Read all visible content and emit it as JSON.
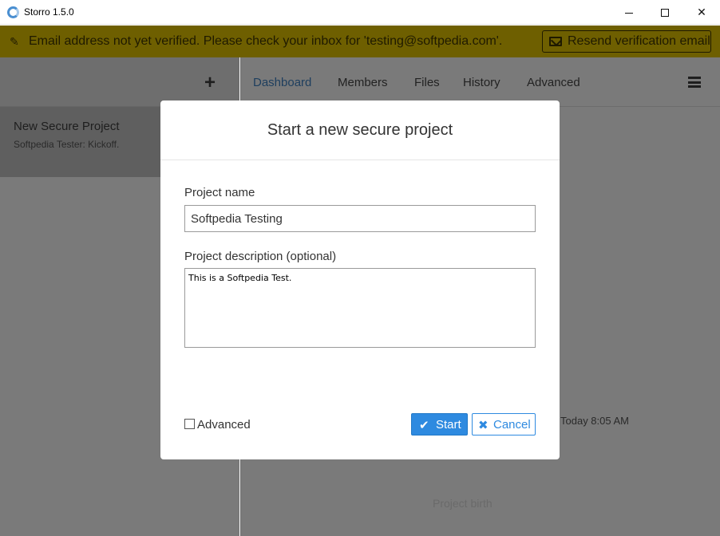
{
  "window": {
    "title": "Storro 1.5.0"
  },
  "banner": {
    "icon": "megaphone-icon",
    "message": "Email address not yet verified. Please check your inbox for 'testing@softpedia.com'.",
    "resend_label": "Resend verification email",
    "resend_icon": "envelope-icon"
  },
  "sidebar": {
    "add_icon": "plus-icon",
    "projects": [
      {
        "title": "New Secure Project",
        "subtitle": "Softpedia Tester: Kickoff."
      }
    ]
  },
  "nav": {
    "tabs": [
      {
        "label": "Dashboard",
        "active": true
      },
      {
        "label": "Members",
        "active": false
      },
      {
        "label": "Files",
        "active": false
      },
      {
        "label": "History",
        "active": false
      },
      {
        "label": "Advanced",
        "active": false
      }
    ],
    "menu_icon": "hamburger-icon"
  },
  "background": {
    "time": "Today 8:05 AM",
    "birth": "Project birth"
  },
  "modal": {
    "title": "Start a new secure project",
    "name_label": "Project name",
    "name_value": "Softpedia Testing",
    "description_label": "Project description (optional)",
    "description_value": "This is a Softpedia Test.",
    "advanced_label": "Advanced",
    "advanced_checked": false,
    "start_label": "Start",
    "cancel_label": "Cancel"
  },
  "colors": {
    "primary": "#2e8ae0",
    "banner_bg": "#6e5f00",
    "overlay": "#7a7a7a"
  }
}
